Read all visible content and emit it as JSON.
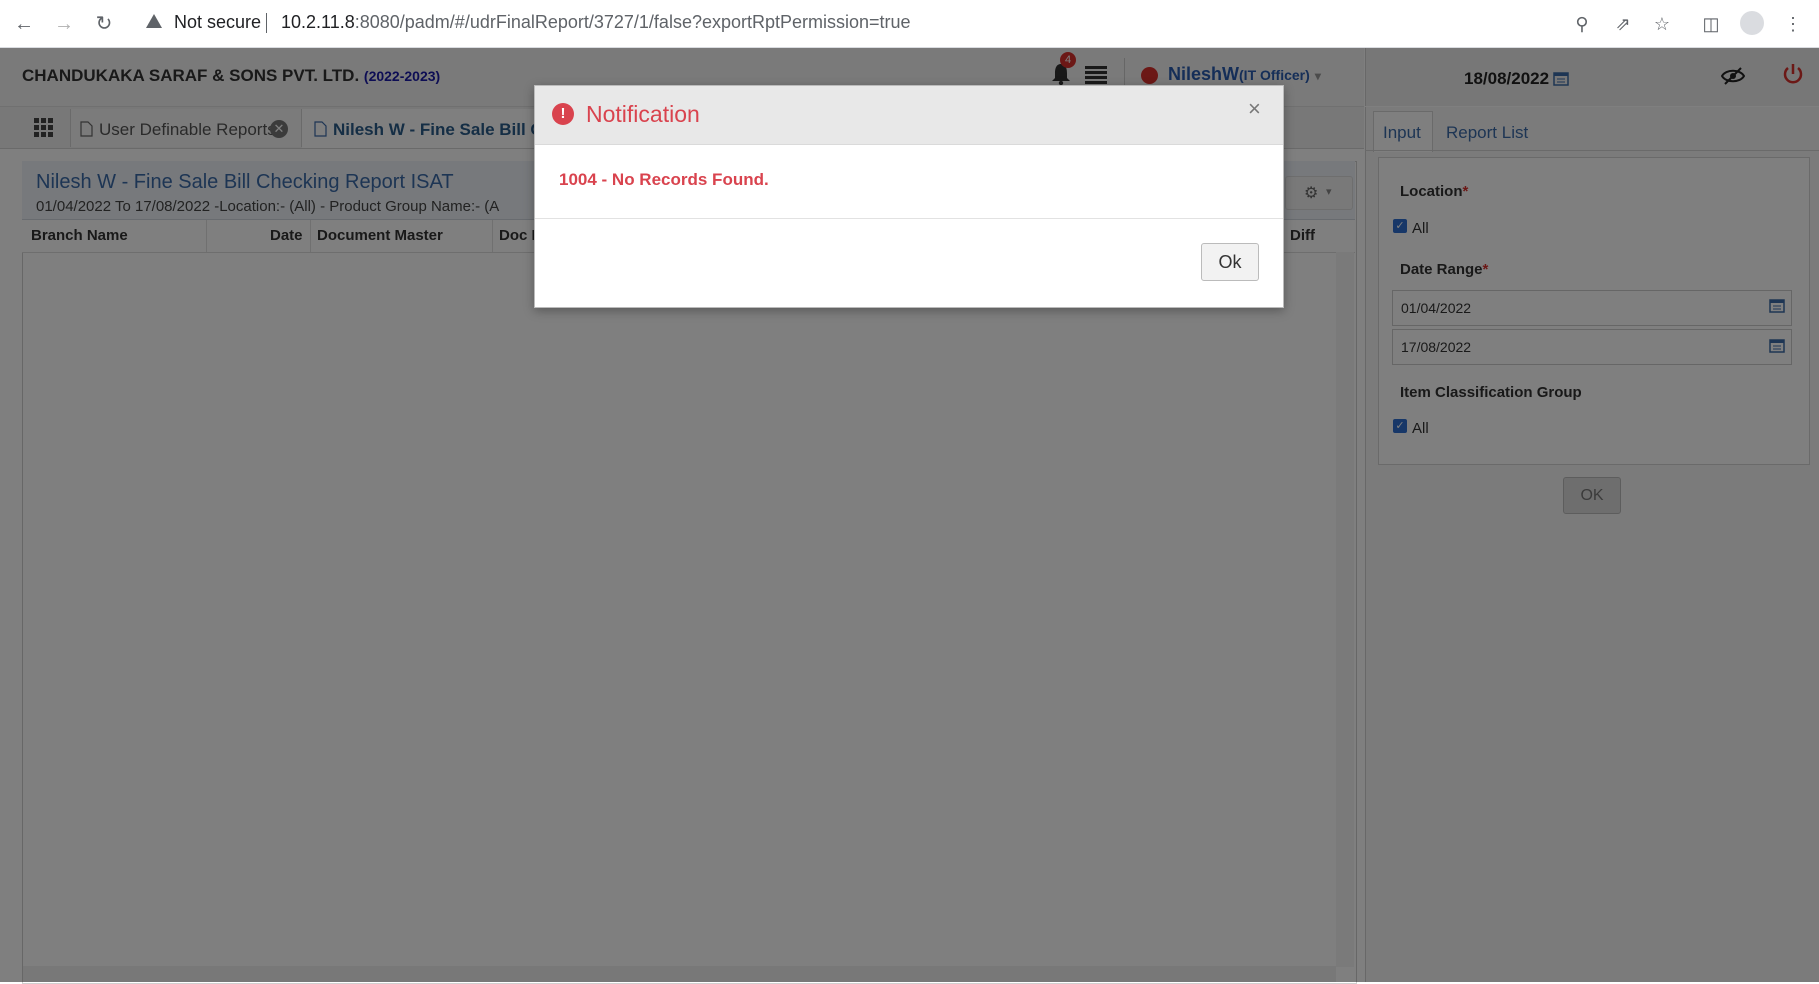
{
  "browser": {
    "security_label": "Not secure",
    "url_host": "10.2.11.8",
    "url_rest": ":8080/padm/#/udrFinalReport/3727/1/false?exportRptPermission=true"
  },
  "header": {
    "company": "CHANDUKAKA SARAF & SONS PVT. LTD.",
    "financial_year": "(2022-2023)",
    "notification_count": "4",
    "user_name": "NileshW",
    "user_role": "(IT Officer)",
    "date": "18/08/2022"
  },
  "tabs": [
    {
      "label": "User Definable Reports"
    },
    {
      "label": "Nilesh W - Fine Sale Bill Ch"
    }
  ],
  "report": {
    "title": "Nilesh W - Fine Sale Bill Checking Report ISAT",
    "subtitle": "01/04/2022 To 17/08/2022 -Location:- (All) - Product Group Name:- (A",
    "columns": [
      "Branch Name",
      "Date",
      "Document Master",
      "Doc I",
      "Diff"
    ]
  },
  "side_panel": {
    "tabs": [
      "Input",
      "Report List"
    ],
    "location_label": "Location",
    "location_all": "All",
    "date_range_label": "Date Range",
    "date_from": "01/04/2022",
    "date_to": "17/08/2022",
    "item_group_label": "Item Classification Group",
    "item_group_all": "All",
    "ok_label": "OK",
    "required_mark": "*"
  },
  "modal": {
    "title": "Notification",
    "message": "1004 - No Records Found.",
    "ok_label": "Ok",
    "close_symbol": "×",
    "icon": "exclamation-circle-icon"
  },
  "colors": {
    "accent_blue": "#3b6aa8",
    "error_red": "#d9434e",
    "checkbox_blue": "#2f6fd1"
  }
}
